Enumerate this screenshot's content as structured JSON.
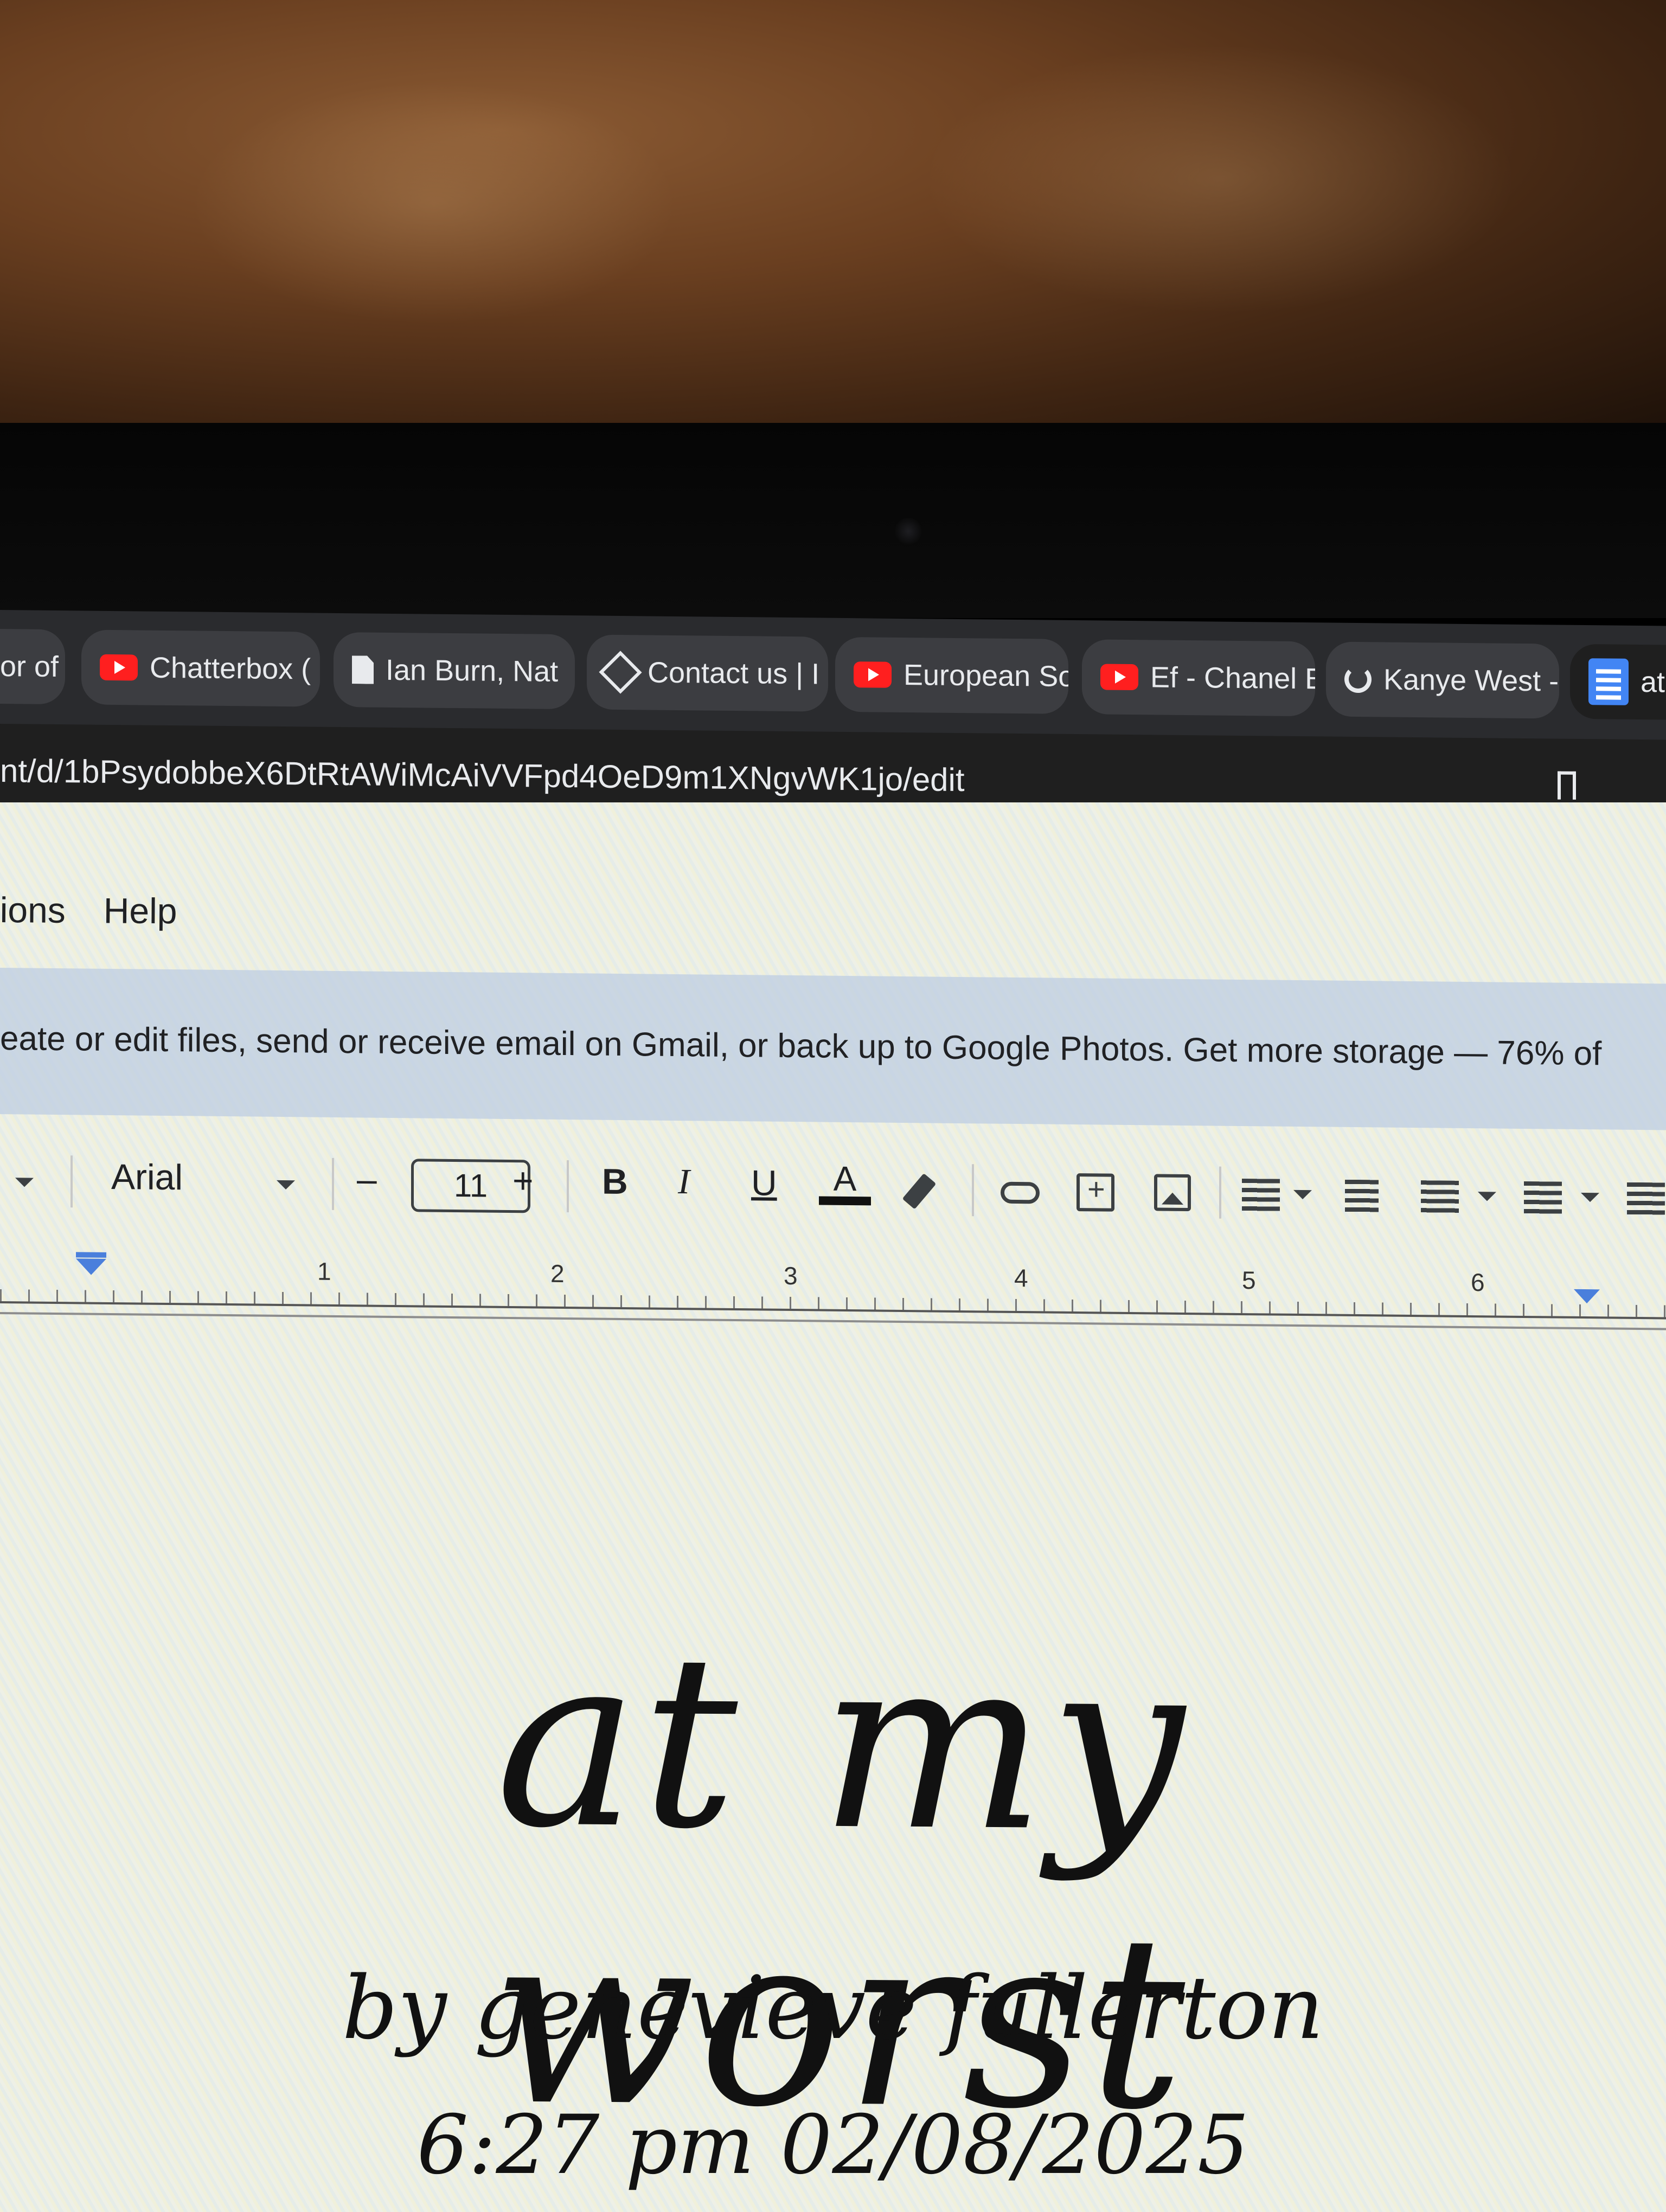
{
  "browser": {
    "tabs": [
      {
        "label": "or of",
        "icon": "none"
      },
      {
        "label": "Chatterbox (",
        "icon": "youtube-icon"
      },
      {
        "label": "Ian Burn, Nat",
        "icon": "document-icon"
      },
      {
        "label": "Contact us | I",
        "icon": "diamond-icon"
      },
      {
        "label": "European So",
        "icon": "youtube-icon"
      },
      {
        "label": "Ef - Chanel B",
        "icon": "youtube-icon"
      },
      {
        "label": "Kanye West -",
        "icon": "swirl-icon"
      },
      {
        "label": "at",
        "icon": "google-docs-icon"
      }
    ],
    "url": "nt/d/1bPsydobbeX6DtRtAWiMcAiVVFpd4OeD9m1XNgvWK1jo/edit"
  },
  "docs": {
    "menu": [
      "ions",
      "Help"
    ],
    "banner_text": "eate or edit files, send or receive email on Gmail, or back up to Google Photos. Get more storage — 76% of",
    "toolbar": {
      "font_name": "Arial",
      "font_size": "11",
      "minus": "–",
      "plus": "+",
      "bold": "B",
      "italic": "I",
      "underline": "U",
      "text_color": "A"
    },
    "ruler_numbers": [
      "1",
      "2",
      "3",
      "4",
      "5",
      "6"
    ]
  },
  "document": {
    "title": "at my worst",
    "byline": "by genevieve fullerton",
    "date": "6:27 pm 02/08/2025"
  }
}
